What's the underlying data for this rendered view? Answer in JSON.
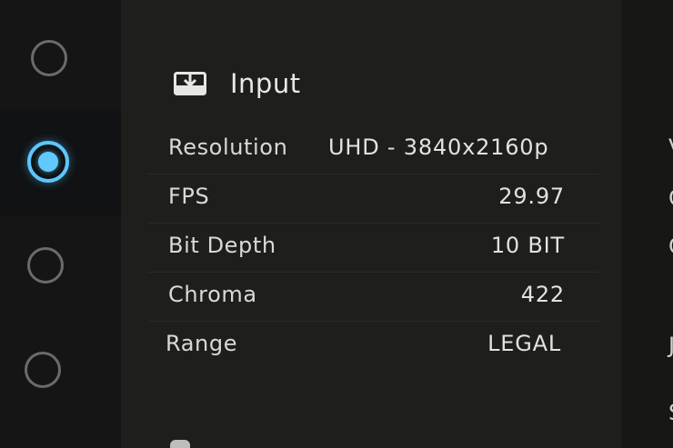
{
  "colors": {
    "accent": "#5cc6ff",
    "background": "#1e1e1d",
    "text": "#e2e2e0",
    "radio_inactive": "#6b6b69"
  },
  "rail": {
    "options": [
      {
        "state": "unselected",
        "icon": "radio-off-icon"
      },
      {
        "state": "selected",
        "icon": "radio-on-icon"
      },
      {
        "state": "unselected",
        "icon": "radio-off-icon"
      },
      {
        "state": "unselected",
        "icon": "radio-off-icon"
      }
    ]
  },
  "panel": {
    "icon": "input-tray-icon",
    "title": "Input",
    "rows": [
      {
        "label": "Resolution",
        "value": "UHD - 3840x2160p"
      },
      {
        "label": "FPS",
        "value": "29.97"
      },
      {
        "label": "Bit Depth",
        "value": "10 BIT"
      },
      {
        "label": "Chroma",
        "value": "422"
      },
      {
        "label": "Range",
        "value": "LEGAL"
      }
    ]
  },
  "right_column": {
    "clipped_chars": [
      "V",
      "C",
      "C",
      "J",
      "S"
    ]
  }
}
